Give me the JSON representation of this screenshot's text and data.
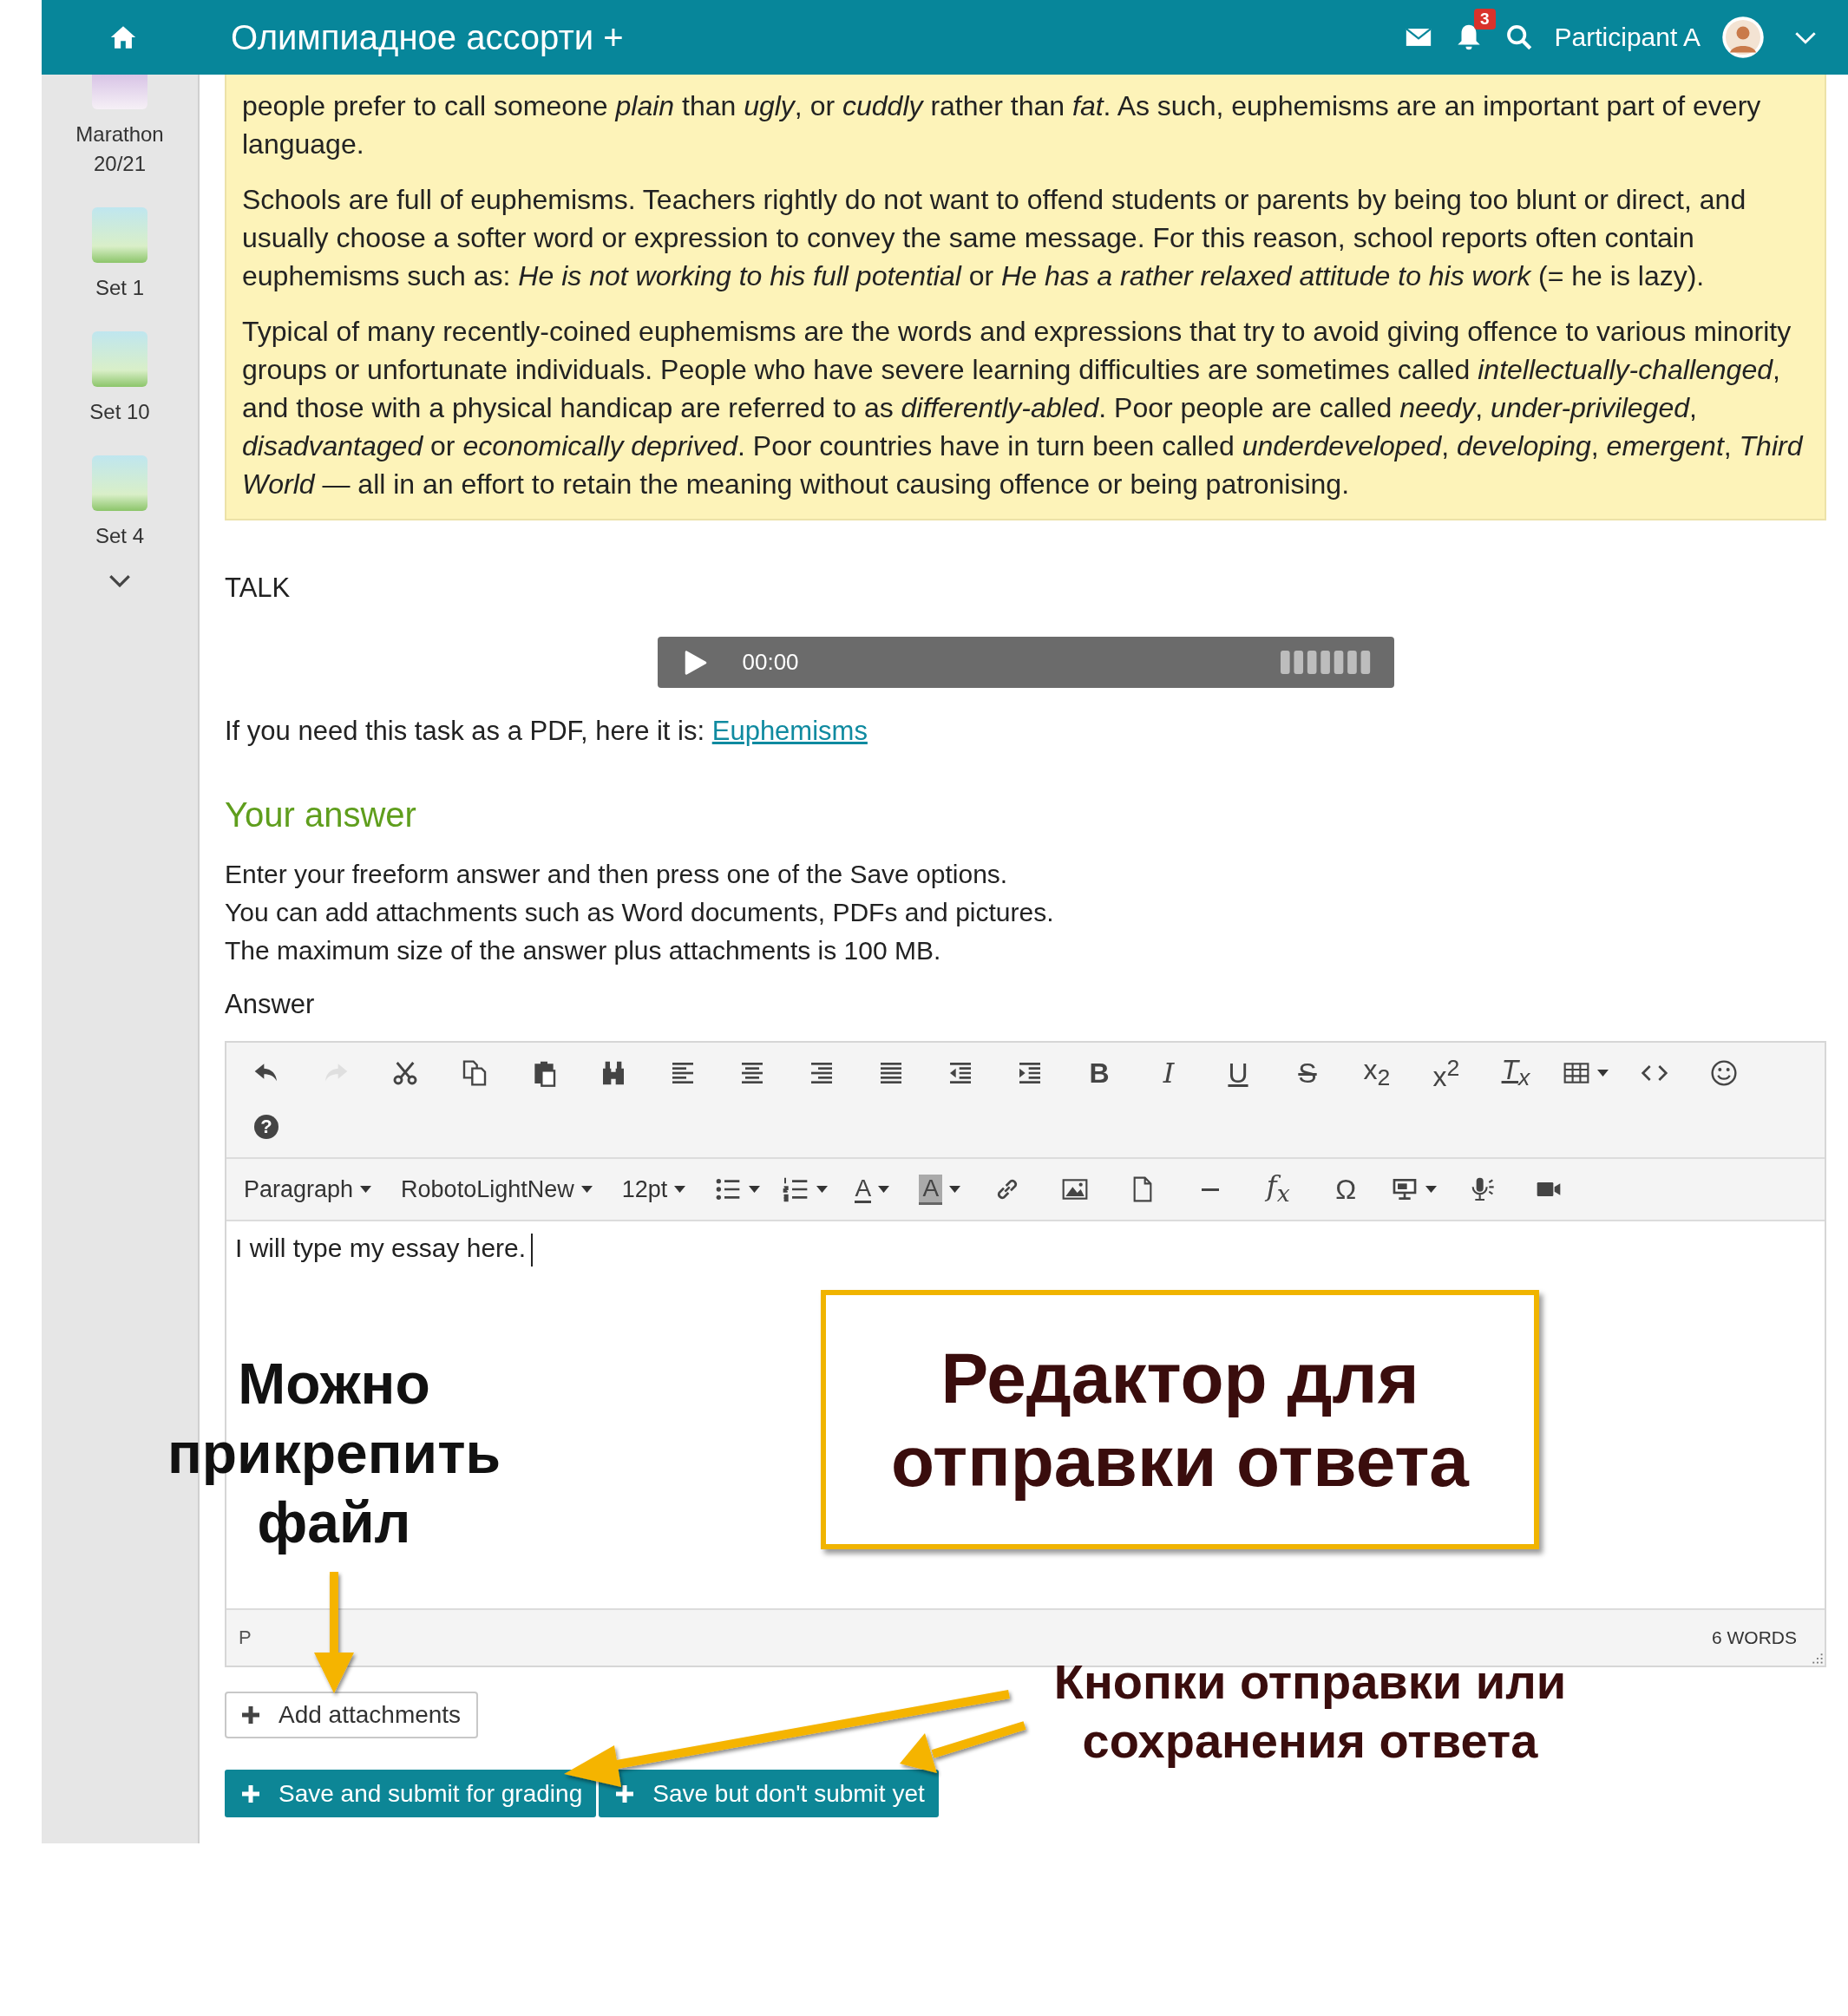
{
  "header": {
    "title": "Олимпиадное ассорти +",
    "notification_count": "3",
    "user_name": "Participant A"
  },
  "sidebar": {
    "items": [
      {
        "label": "Marathon 20/21",
        "cut": true
      },
      {
        "label": "Set 1",
        "cut": false
      },
      {
        "label": "Set 10",
        "cut": false
      },
      {
        "label": "Set 4",
        "cut": false
      }
    ]
  },
  "reading": [
    "people prefer to call someone *plain* than *ugly*, or *cuddly* rather than *fat*. As such, euphemisms are an important part of every language.",
    "Schools are full of euphemisms. Teachers rightly do not want to offend students or parents by being too blunt or direct, and usually choose a softer word or expression to convey the same message. For this reason, school reports often contain euphemisms such as: *He is not working to his full potential* or *He has a rather relaxed attitude to his work* (= he is lazy).",
    "Typical of many recently-coined euphemisms are the words and expressions that try to avoid giving offence to various minority groups or unfortunate individuals. People who have severe learning difficulties are sometimes called *intellectually-challenged*, and those with a physical handicap are referred to as *differently-abled*. Poor people are called *needy*, *under-privileged*, *disadvantaged* or *economically deprived*. Poor countries have in turn been called *underdeveloped*, *developing*, *emergent*, *Third World* — all in an effort to retain the meaning without causing offence or being patronising."
  ],
  "section_label": "TALK",
  "audio_player": {
    "time": "00:00"
  },
  "pdf_line": {
    "text": "If you need this task as a PDF, here it is:",
    "link": "Euphemisms"
  },
  "answer_heading": "Your answer",
  "instructions": [
    "Enter your freeform answer and then press one of the Save options.",
    "You can add attachments such as Word documents, PDFs and pictures.",
    "The maximum size of the answer plus attachments is 100 MB."
  ],
  "answer_label": "Answer",
  "editor": {
    "toolbar_row_1": [
      {
        "kind": "undo",
        "disabled": false
      },
      {
        "kind": "redo",
        "disabled": true
      },
      {
        "kind": "cut",
        "disabled": false
      },
      {
        "kind": "copy",
        "disabled": false
      },
      {
        "kind": "paste",
        "disabled": false
      },
      {
        "kind": "find",
        "disabled": false
      },
      {
        "kind": "align-left",
        "disabled": false
      },
      {
        "kind": "align-center",
        "disabled": false
      },
      {
        "kind": "align-right",
        "disabled": false
      },
      {
        "kind": "justify",
        "disabled": false
      },
      {
        "kind": "outdent",
        "disabled": false
      },
      {
        "kind": "indent",
        "disabled": false
      },
      {
        "kind": "bold",
        "glyph": "B",
        "disabled": false
      },
      {
        "kind": "italic",
        "glyph": "I",
        "disabled": false
      },
      {
        "kind": "underline",
        "glyph": "U",
        "disabled": false
      },
      {
        "kind": "strikethrough",
        "glyph": "S",
        "disabled": false
      },
      {
        "kind": "subscript",
        "glyph": "x$_{2}$",
        "disabled": false
      },
      {
        "kind": "superscript",
        "glyph": "x$^{2}$",
        "disabled": false
      },
      {
        "kind": "clear-formatting",
        "glyph": "T$_{x}$",
        "disabled": false
      },
      {
        "kind": "table",
        "caret": true,
        "disabled": false
      },
      {
        "kind": "code",
        "disabled": false
      },
      {
        "kind": "emoji",
        "disabled": false
      },
      {
        "kind": "help",
        "glyph": "?",
        "disabled": false
      }
    ],
    "toolbar_row_2": [
      {
        "kind": "dropdown",
        "label": "Paragraph",
        "disabled": false
      },
      {
        "kind": "dropdown",
        "label": "RobotoLightNew",
        "disabled": false
      },
      {
        "kind": "dropdown",
        "label": "12pt",
        "disabled": false
      },
      {
        "kind": "bullets",
        "caret": true,
        "disabled": false
      },
      {
        "kind": "numbers",
        "caret": true,
        "disabled": false
      },
      {
        "kind": "text-color",
        "glyph": "A",
        "caret": true,
        "disabled": false
      },
      {
        "kind": "highlight",
        "glyph": "A",
        "caret": true,
        "disabled": false
      },
      {
        "kind": "link",
        "disabled": false
      },
      {
        "kind": "image",
        "disabled": false
      },
      {
        "kind": "file",
        "disabled": false
      },
      {
        "kind": "hr",
        "disabled": false
      },
      {
        "kind": "formula",
        "glyph": "f$_{x}$",
        "disabled": false
      },
      {
        "kind": "symbol",
        "glyph": "Ω",
        "disabled": false
      },
      {
        "kind": "media",
        "caret": true,
        "disabled": false
      },
      {
        "kind": "mic",
        "disabled": false
      },
      {
        "kind": "video",
        "disabled": false
      }
    ],
    "content": "I will type my essay here.",
    "path": "P",
    "word_count": "6 WORDS"
  },
  "attach_button": "Add attachments",
  "save_buttons": [
    "Save and submit for grading",
    "Save but don't submit yet"
  ],
  "annotations": {
    "attach_note": "Можно прикрепить файл",
    "editor_note": "Редактор для отправки ответа",
    "buttons_note": "Кнопки отправки или сохранения ответа"
  }
}
